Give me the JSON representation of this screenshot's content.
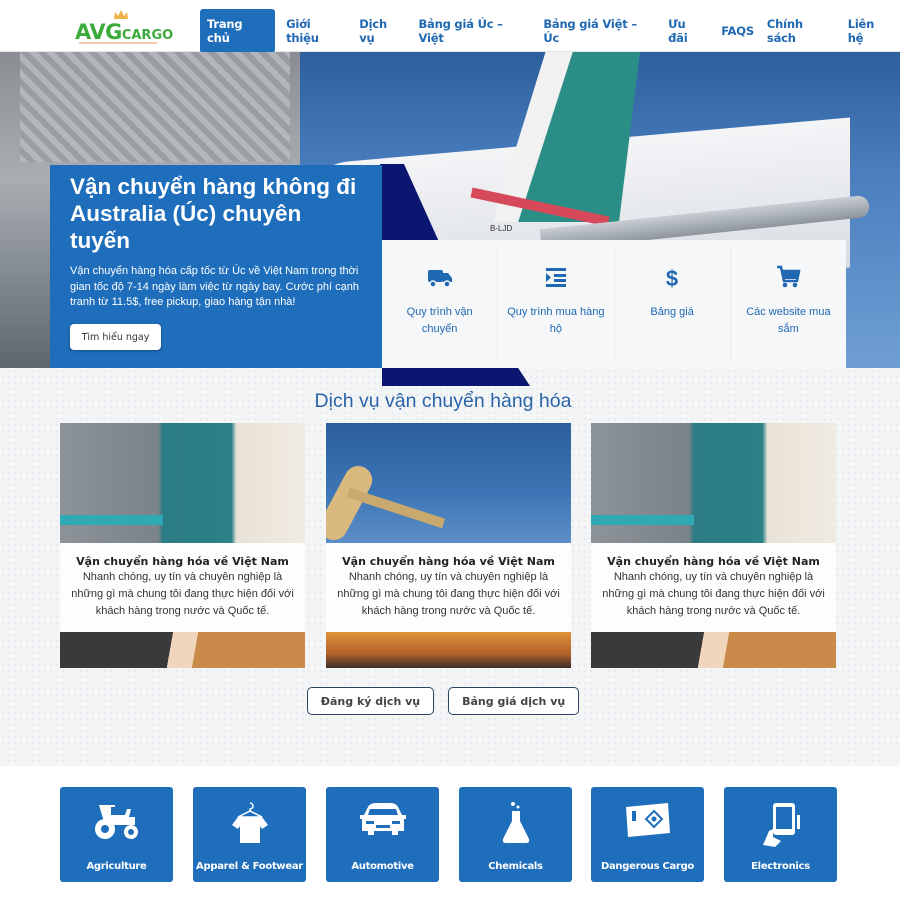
{
  "brand": {
    "name_main": "AVG",
    "name_sub": "CARGO",
    "primary_color": "#1f6ebc",
    "navy_color": "#0b1670",
    "logo_color": "#3bab3b"
  },
  "nav": {
    "items": [
      {
        "label": "Trang chủ",
        "active": true
      },
      {
        "label": "Giới thiệu"
      },
      {
        "label": "Dịch vụ"
      },
      {
        "label": "Bảng giá Úc – Việt"
      },
      {
        "label": "Bảng giá Việt – Úc"
      },
      {
        "label": "Ưu đãi"
      },
      {
        "label": "FAQS"
      },
      {
        "label": "Chính sách"
      },
      {
        "label": "Liên hệ"
      }
    ]
  },
  "hero": {
    "title": "Vận chuyển hàng không đi Australia (Úc) chuyên tuyến",
    "description": "Vận chuyển hàng hóa cấp tốc từ Úc về Việt Nam trong thời gian tốc độ 7-14 ngày làm việc từ ngày bay. Cước phí cạnh tranh từ 11.5$, free pickup, giao hàng tận nhà!",
    "cta_label": "Tìm hiểu ngay",
    "registration_mark": "B-LJD"
  },
  "quick_links": [
    {
      "icon": "truck-icon",
      "label": "Quy trình vận chuyển"
    },
    {
      "icon": "indent-list-icon",
      "label": "Quy trình mua hàng hộ"
    },
    {
      "icon": "dollar-icon",
      "label": "Bảng giá"
    },
    {
      "icon": "shopping-cart-icon",
      "label": "Các website mua sắm"
    }
  ],
  "services": {
    "heading": "Dịch vụ vận chuyển hàng hóa",
    "cards": [
      {
        "title": "Vận chuyển hàng hóa về Việt Nam",
        "description": "Nhanh chóng, uy tín và chuyên nghiệp là những gì mà chung tôi đang thực hiện đối với khách hàng trong nước và Quốc tế.",
        "image": "truck"
      },
      {
        "title": "Vận chuyển hàng hóa về Việt Nam",
        "description": "Nhanh chóng, uy tín và chuyên nghiệp là những gì mà chung tôi đang thực hiện đối với khách hàng trong nước và Quốc tế.",
        "image": "airplane"
      },
      {
        "title": "Vận chuyển hàng hóa về Việt Nam",
        "description": "Nhanh chóng, uy tín và chuyên nghiệp là những gì mà chung tôi đang thực hiện đối với khách hàng trong nước và Quốc tế.",
        "image": "truck"
      }
    ],
    "register_label": "Đăng ký dịch vụ",
    "pricing_label": "Bảng giá dịch vụ"
  },
  "categories": [
    {
      "icon": "tractor-icon",
      "label": "Agriculture"
    },
    {
      "icon": "shirt-hanger-icon",
      "label": "Apparel & Footwear"
    },
    {
      "icon": "car-icon",
      "label": "Automotive"
    },
    {
      "icon": "flask-icon",
      "label": "Chemicals"
    },
    {
      "icon": "hazard-box-icon",
      "label": "Dangerous Cargo"
    },
    {
      "icon": "tablet-hand-icon",
      "label": "Electronics"
    }
  ]
}
